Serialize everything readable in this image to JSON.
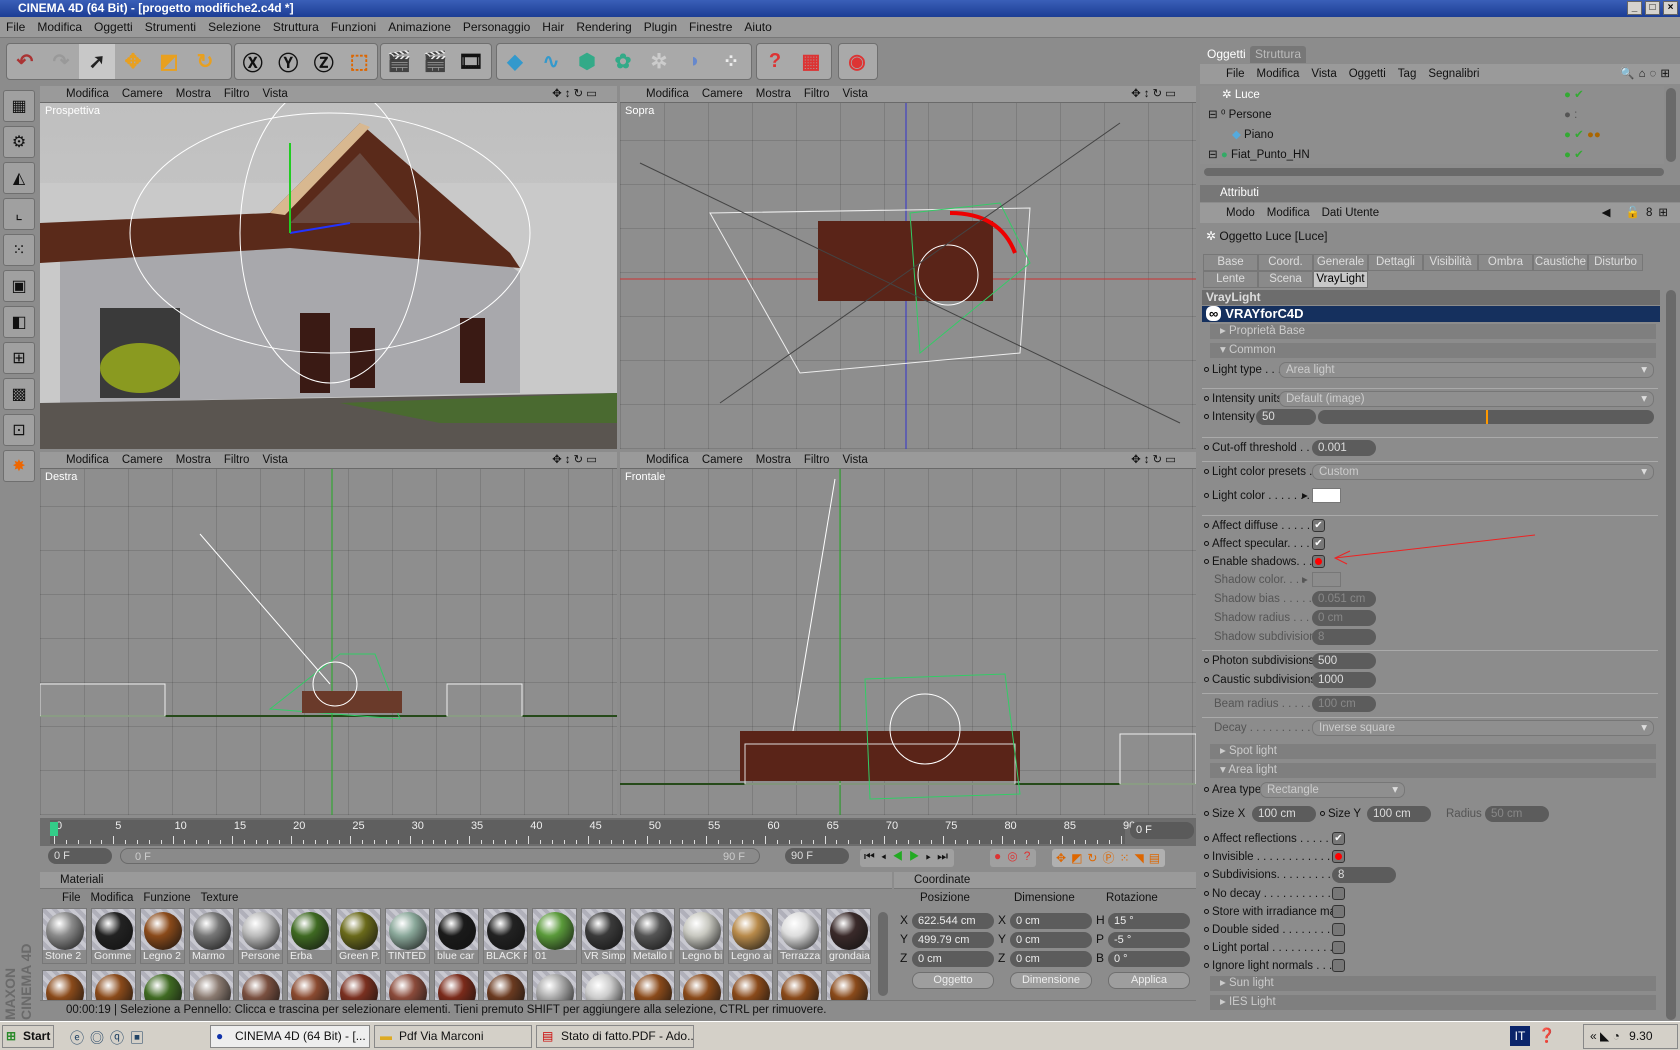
{
  "window": {
    "title": "CINEMA 4D (64 Bit) - [progetto modifiche2.c4d *]"
  },
  "menu": [
    "File",
    "Modifica",
    "Oggetti",
    "Strumenti",
    "Selezione",
    "Struttura",
    "Funzioni",
    "Animazione",
    "Personaggio",
    "Hair",
    "Rendering",
    "Plugin",
    "Finestre",
    "Aiuto"
  ],
  "viewport_menu": [
    "Modifica",
    "Camere",
    "Mostra",
    "Filtro",
    "Vista"
  ],
  "viewports": [
    {
      "label": "Prospettiva"
    },
    {
      "label": "Sopra"
    },
    {
      "label": "Destra"
    },
    {
      "label": "Frontale"
    }
  ],
  "timeline": {
    "ticks": [
      "0",
      "5",
      "10",
      "15",
      "20",
      "25",
      "30",
      "35",
      "40",
      "45",
      "50",
      "55",
      "60",
      "65",
      "70",
      "75",
      "80",
      "85",
      "90"
    ],
    "current_frame": "0 F",
    "range_start": "0 F",
    "range_slider_start": "0 F",
    "range_slider_end": "90 F",
    "range_end": "90 F"
  },
  "materials": {
    "title": "Materiali",
    "menu": [
      "File",
      "Modifica",
      "Funzione",
      "Texture"
    ],
    "items": [
      {
        "name": "Stone 2",
        "color": "#8a8a8a"
      },
      {
        "name": "Gomme",
        "color": "#222"
      },
      {
        "name": "Legno 2",
        "color": "#8a4a1a"
      },
      {
        "name": "Marmo",
        "color": "#777"
      },
      {
        "name": "Persone",
        "color": "#bbb"
      },
      {
        "name": "Erba",
        "color": "#3f6a22"
      },
      {
        "name": "Green P.",
        "color": "#6a6a1a"
      },
      {
        "name": "TINTED",
        "color": "#8aa89a"
      },
      {
        "name": "blue car",
        "color": "#1a1a1a"
      },
      {
        "name": "BLACK F",
        "color": "#222"
      },
      {
        "name": "01",
        "color": "#5a9a3a"
      },
      {
        "name": "VR Simp",
        "color": "#3a3a3a"
      },
      {
        "name": "Metallo l",
        "color": "#555"
      },
      {
        "name": "Legno bi",
        "color": "#c8c8c0"
      },
      {
        "name": "Legno ai",
        "color": "#b88a4a"
      },
      {
        "name": "Terrazza",
        "color": "#ddd"
      },
      {
        "name": "grondaia",
        "color": "#3a2a2a"
      }
    ],
    "row2_colors": [
      "#8a4a1a",
      "#8a4a1a",
      "#3f6a22",
      "#8a7a70",
      "#7a5040",
      "#8a4a30",
      "#7a3020",
      "#8a4a3a",
      "#7a2a1a",
      "#6a3a20",
      "#aaa",
      "#ccc",
      "#8a4a1a",
      "#8a4a1a",
      "#8a4a1a",
      "#8a4a1a",
      "#8a4a1a"
    ]
  },
  "coordinates": {
    "title": "Coordinate",
    "headers": [
      "Posizione",
      "Dimensione",
      "Rotazione"
    ],
    "position": {
      "X": "622.544 cm",
      "Y": "499.79 cm",
      "Z": "0 cm"
    },
    "size": {
      "X": "0 cm",
      "Y": "0 cm",
      "Z": "0 cm"
    },
    "rotation": {
      "H": "15 °",
      "P": "-5 °",
      "B": "0 °"
    },
    "mode": "Oggetto",
    "size_mode": "Dimensione",
    "apply": "Applica"
  },
  "status": {
    "time": "00:00:19",
    "message": "Selezione a Pennello: Clicca e trascina per selezionare elementi. Tieni premuto SHIFT per aggiungere alla selezione, CTRL per rimuovere."
  },
  "logo": "MAXON CINEMA 4D",
  "objects": {
    "tabs": [
      "Oggetti",
      "Struttura"
    ],
    "menu": [
      "File",
      "Modifica",
      "Vista",
      "Oggetti",
      "Tag",
      "Segnalibri"
    ],
    "items": [
      {
        "name": "Luce",
        "selected": true
      },
      {
        "name": "Persone"
      },
      {
        "name": "Piano"
      },
      {
        "name": "Fiat_Punto_HN"
      }
    ]
  },
  "attributes": {
    "title": "Attributi",
    "menu": [
      "Modo",
      "Modifica",
      "Dati Utente"
    ],
    "object_title": "Oggetto Luce [Luce]",
    "tabs_row1": [
      "Base",
      "Coord.",
      "Generale",
      "Dettagli",
      "Visibilità",
      "Ombra",
      "Caustiche",
      "Disturbo"
    ],
    "tabs_row2": [
      "Lente",
      "Scena",
      "VrayLight"
    ],
    "active_tab": "VrayLight",
    "section": "VrayLight",
    "banner": "VRAYforC4D",
    "rows": [
      {
        "type": "sect",
        "label": "Proprietà Base",
        "open": false
      },
      {
        "type": "sect",
        "label": "Common",
        "open": true
      },
      {
        "type": "dd",
        "label": "Light type . . .",
        "value": "Area light",
        "at": 75
      },
      {
        "type": "sep"
      },
      {
        "type": "dd",
        "label": "Intensity units",
        "value": "Default (image)",
        "at": 75
      },
      {
        "type": "slider",
        "label": "Intensity",
        "value": "50",
        "fraction": 0.5
      },
      {
        "type": "sep"
      },
      {
        "type": "num",
        "label": "Cut-off threshold . . . .",
        "value": "0.001"
      },
      {
        "type": "sep"
      },
      {
        "type": "dd",
        "label": "Light color presets . .",
        "value": "Custom",
        "at": 108
      },
      {
        "type": "color",
        "label": "Light color . . . . . . .",
        "value": "#ffffff"
      },
      {
        "type": "sep"
      },
      {
        "type": "cb",
        "label": "Affect diffuse . . . . . .",
        "value": "checked"
      },
      {
        "type": "cb",
        "label": "Affect specular. . . . .",
        "value": "checked"
      },
      {
        "type": "cb",
        "label": "Enable shadows. . . .",
        "value": "red"
      },
      {
        "type": "color",
        "label": "Shadow color. . . .",
        "value": "#8c8c8c",
        "disabled": true
      },
      {
        "type": "num",
        "label": "Shadow bias . . . . . .",
        "value": "0.051 cm",
        "disabled": true
      },
      {
        "type": "num",
        "label": "Shadow radius . . . . .",
        "value": "0 cm",
        "disabled": true
      },
      {
        "type": "num",
        "label": "Shadow subdivisions",
        "value": "8",
        "disabled": true
      },
      {
        "type": "sep"
      },
      {
        "type": "num",
        "label": "Photon subdivisions",
        "value": "500"
      },
      {
        "type": "num",
        "label": "Caustic subdivisions",
        "value": "1000"
      },
      {
        "type": "sep"
      },
      {
        "type": "num",
        "label": "Beam radius . . . . . . .",
        "value": "100 cm",
        "disabled": true
      },
      {
        "type": "sep"
      },
      {
        "type": "dd",
        "label": "Decay . . . . . . . . . . .",
        "value": "Inverse square",
        "at": 108,
        "disabled": true
      },
      {
        "type": "sect",
        "label": "Spot light",
        "open": false
      },
      {
        "type": "sect",
        "label": "Area light",
        "open": true
      },
      {
        "type": "dd",
        "label": "Area type",
        "value": "Rectangle",
        "at": 56,
        "width": 145
      },
      {
        "type": "sizes",
        "sizex_label": "Size X",
        "sizex": "100 cm",
        "sizey_label": "Size Y",
        "sizey": "100 cm",
        "radius_label": "Radius",
        "radius": "50 cm"
      },
      {
        "type": "cb",
        "label": "Affect reflections . . . . . .",
        "value": "checked",
        "at": 128
      },
      {
        "type": "cb",
        "label": "Invisible . . . . . . . . . . . . .",
        "value": "red",
        "at": 128
      },
      {
        "type": "num",
        "label": "Subdivisions. . . . . . . . . .",
        "value": "8",
        "at": 128
      },
      {
        "type": "cb",
        "label": "No decay . . . . . . . . . . . .",
        "value": "",
        "at": 128
      },
      {
        "type": "cb",
        "label": "Store with irradiance map",
        "value": "",
        "at": 128
      },
      {
        "type": "cb",
        "label": "Double sided . . . . . . . . .",
        "value": "",
        "at": 128
      },
      {
        "type": "cb",
        "label": "Light portal . . . . . . . . . . .",
        "value": "",
        "at": 128
      },
      {
        "type": "cb",
        "label": "Ignore light normals . . . .",
        "value": "",
        "at": 128
      },
      {
        "type": "sect",
        "label": "Sun light",
        "open": false
      },
      {
        "type": "sect",
        "label": "IES Light",
        "open": false
      }
    ]
  },
  "taskbar": {
    "start": "Start",
    "tasks": [
      "CINEMA 4D (64 Bit) - [...",
      "Pdf Via Marconi",
      "Stato di fatto.PDF - Ado..."
    ],
    "language": "IT",
    "clock": "9.30"
  }
}
